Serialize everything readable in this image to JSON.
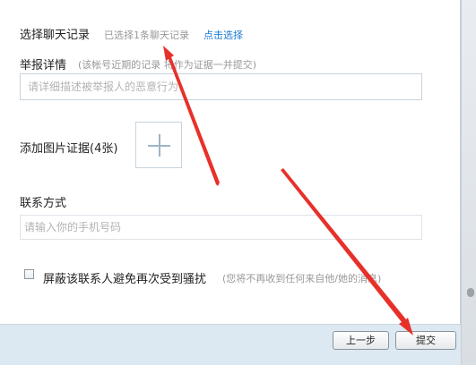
{
  "report": {
    "section_title": "选择聊天记录",
    "selected_status": "已选择1条聊天记录",
    "click_select": "点击选择",
    "detail_label": "举报详情",
    "detail_hint": "(该帐号近期的记录 将作为证据一并提交)",
    "detail_placeholder": "请详细描述被举报人的恶意行为",
    "image_label": "添加图片证据(4张)",
    "contact_label": "联系方式",
    "phone_placeholder": "请输入你的手机号码",
    "block_label": "屏蔽该联系人避免再次受到骚扰",
    "block_hint": "(您将不再收到任何来自他/她的消息)",
    "block_checked": false
  },
  "footer": {
    "prev_label": "上一步",
    "submit_label": "提交"
  },
  "icons": {
    "add_image": "plus-icon",
    "annotation": "red-arrow-icon"
  },
  "colors": {
    "link": "#1a7bd3",
    "hint": "#999999",
    "footer_bg": "#dce8f2",
    "annotation": "#e8302a"
  }
}
